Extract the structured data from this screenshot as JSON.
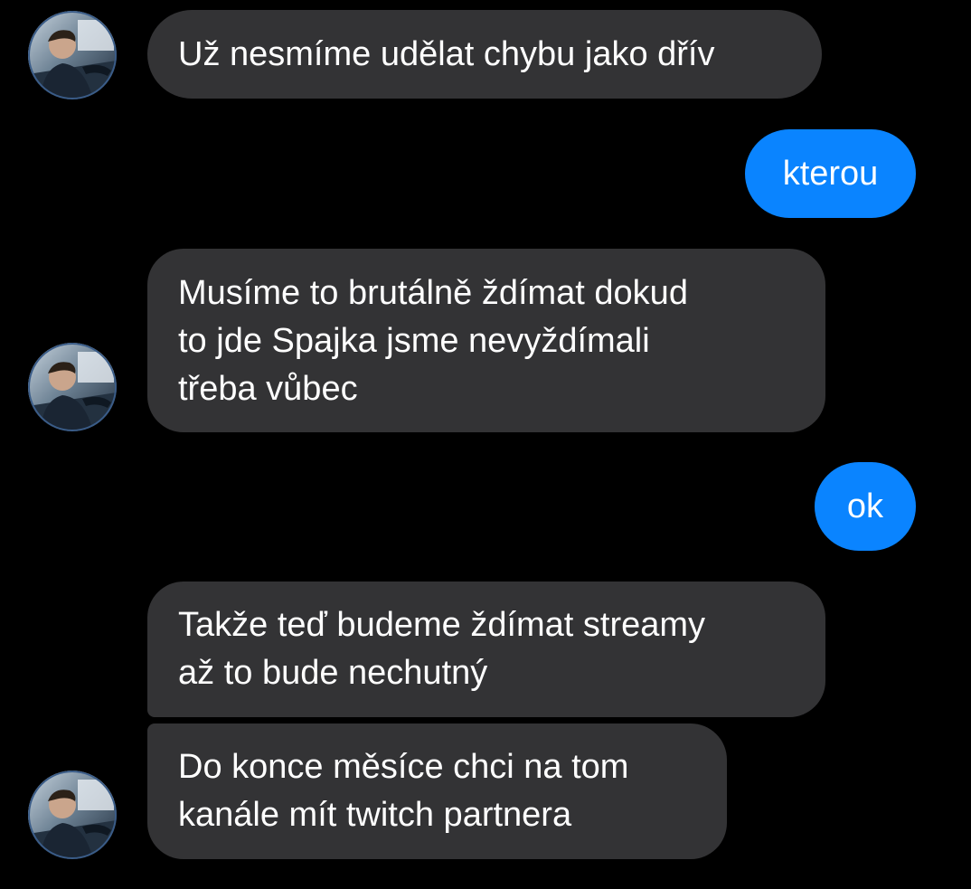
{
  "conversation": {
    "incoming_color": "#333335",
    "outgoing_color": "#0a84ff",
    "avatar_icon": "contact-avatar",
    "messages": [
      {
        "direction": "incoming",
        "lines": [
          "Už nesmíme udělat chybu jako dřív"
        ]
      },
      {
        "direction": "outgoing",
        "lines": [
          "kterou"
        ]
      },
      {
        "direction": "incoming",
        "lines": [
          "Musíme to brutálně ždímat dokud",
          "to jde Spajka jsme nevyždímali",
          "třeba vůbec"
        ]
      },
      {
        "direction": "outgoing",
        "lines": [
          "ok"
        ]
      },
      {
        "direction": "incoming",
        "lines": [
          "Takže teď budeme ždímat streamy",
          "až to bude nechutný"
        ]
      },
      {
        "direction": "incoming",
        "lines": [
          "Do konce měsíce chci na tom",
          "kanále mít twitch partnera"
        ]
      }
    ]
  }
}
